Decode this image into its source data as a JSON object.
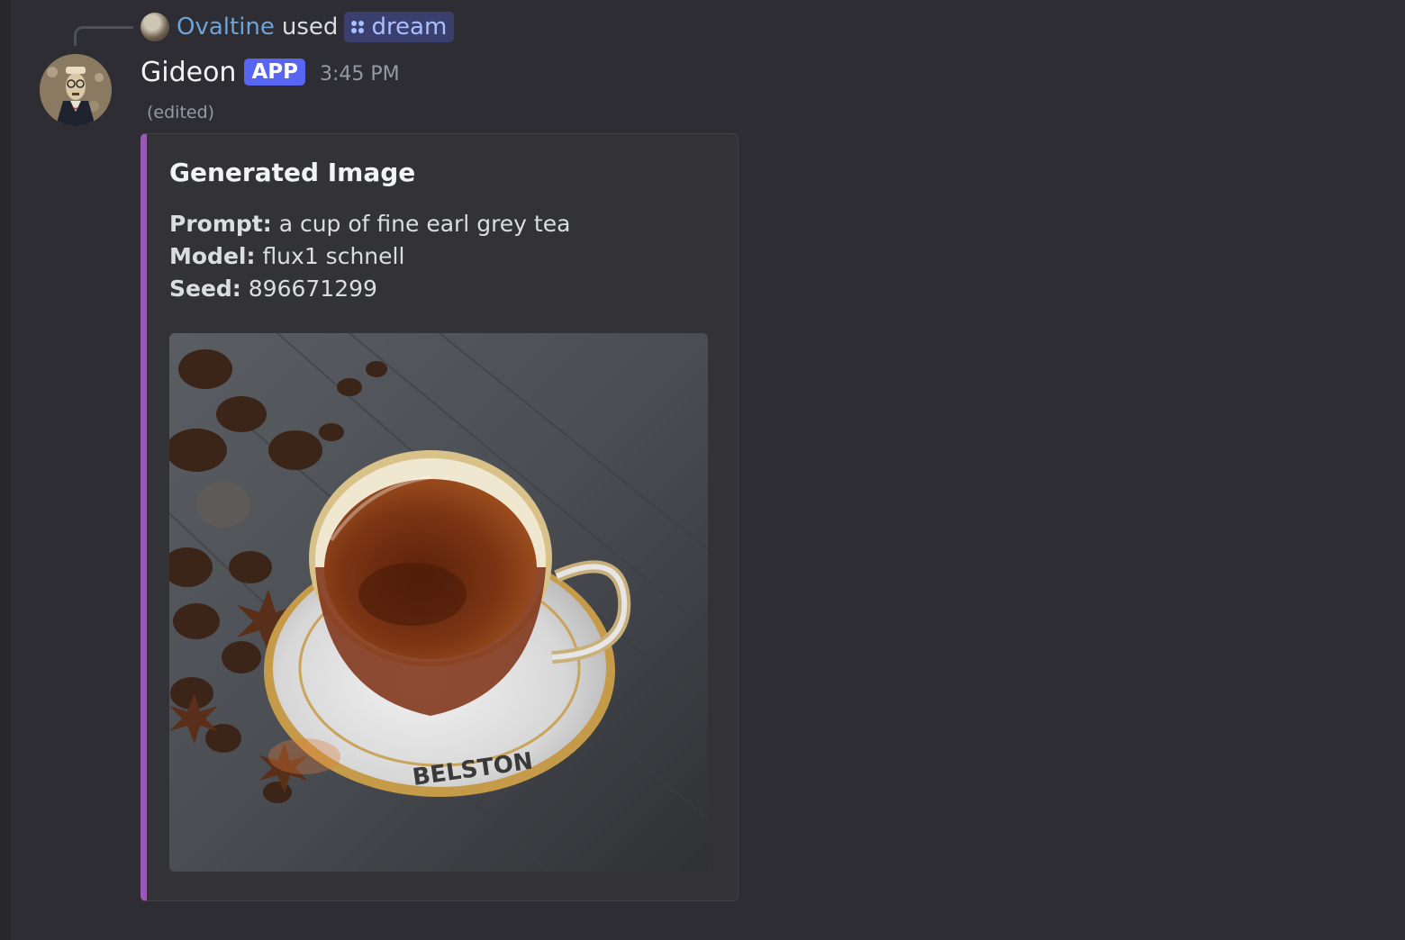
{
  "reply": {
    "user": "Ovaltine",
    "verb": "used",
    "command": "dream"
  },
  "message": {
    "author": "Gideon",
    "tag": "APP",
    "timestamp": "3:45 PM",
    "edited": "(edited)"
  },
  "embed": {
    "title": "Generated Image",
    "fields": [
      {
        "label": "Prompt:",
        "value": "a cup of fine earl grey tea"
      },
      {
        "label": "Model:",
        "value": "flux1 schnell"
      },
      {
        "label": "Seed:",
        "value": "896671299"
      }
    ],
    "image": {
      "saucer_text": "BELSTON"
    }
  },
  "colors": {
    "background": "#2d2d33",
    "embed_accent": "#9b59b6",
    "app_tag": "#5865f2",
    "reply_user": "#6fa3d7"
  }
}
